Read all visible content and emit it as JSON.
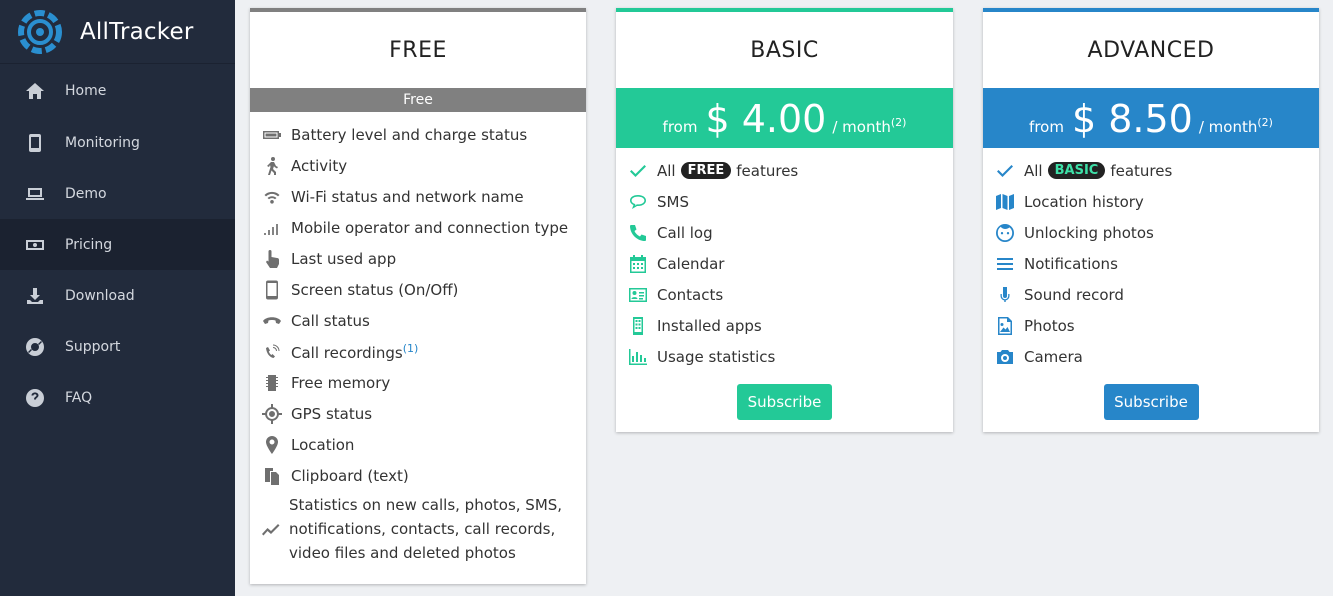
{
  "app": {
    "title": "AllTracker"
  },
  "sidebar": {
    "items": [
      {
        "label": "Home",
        "icon": "home-icon"
      },
      {
        "label": "Monitoring",
        "icon": "phone-icon"
      },
      {
        "label": "Demo",
        "icon": "laptop-icon"
      },
      {
        "label": "Pricing",
        "icon": "money-icon",
        "active": true
      },
      {
        "label": "Download",
        "icon": "download-icon"
      },
      {
        "label": "Support",
        "icon": "lifebuoy-icon"
      },
      {
        "label": "FAQ",
        "icon": "question-icon"
      }
    ]
  },
  "plans": {
    "free": {
      "title": "FREE",
      "bar_label": "Free",
      "features": [
        "Battery level and charge status",
        "Activity",
        "Wi-Fi status and network name",
        "Mobile operator and connection type",
        "Last used app",
        "Screen status (On/Off)",
        "Call status",
        "Call recordings",
        "Free memory",
        "GPS status",
        "Location",
        "Clipboard (text)",
        "Statistics on new calls, photos, SMS, notifications, contacts, call records, video files and deleted photos"
      ],
      "call_recordings_note": "(1)"
    },
    "basic": {
      "title": "BASIC",
      "from": "from",
      "price": "$ 4.00",
      "per": "/ month",
      "note": "(2)",
      "all_prefix": "All",
      "all_pill": "FREE",
      "all_suffix": "features",
      "features": [
        "SMS",
        "Call log",
        "Calendar",
        "Contacts",
        "Installed apps",
        "Usage statistics"
      ],
      "button": "Subscribe"
    },
    "advanced": {
      "title": "ADVANCED",
      "from": "from",
      "price": "$ 8.50",
      "per": "/ month",
      "note": "(2)",
      "all_prefix": "All",
      "all_pill": "BASIC",
      "all_suffix": "features",
      "features": [
        "Location history",
        "Unlocking photos",
        "Notifications",
        "Sound record",
        "Photos",
        "Camera"
      ],
      "button": "Subscribe"
    }
  },
  "colors": {
    "sidebar": "#222b3c",
    "basic": "#23c997",
    "advanced": "#2786c9",
    "free": "#808080"
  }
}
